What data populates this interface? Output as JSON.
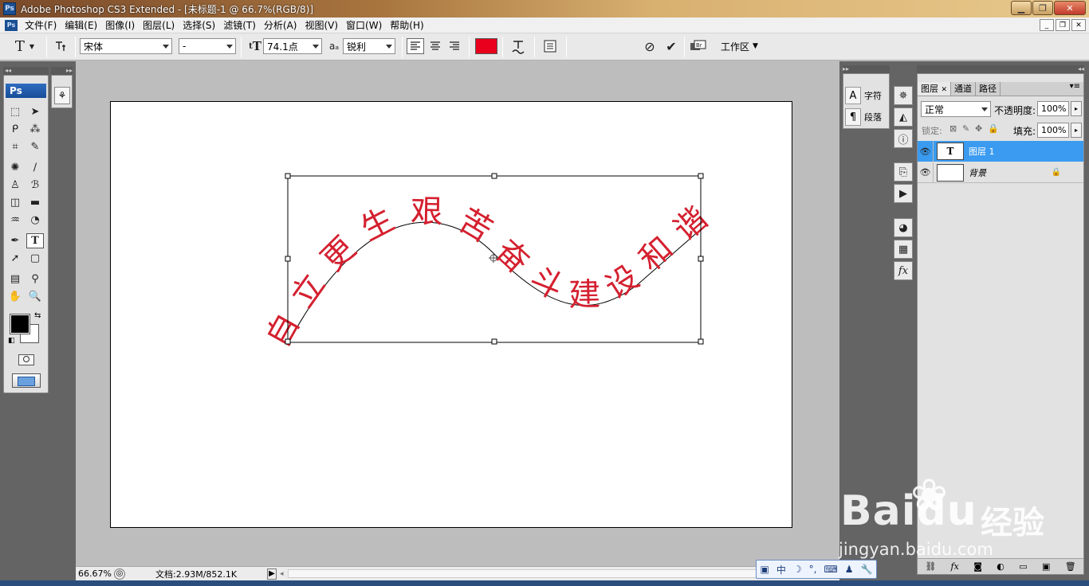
{
  "titlebar": {
    "icon_text": "Ps",
    "title": "Adobe Photoshop CS3 Extended - [未标题-1 @ 66.7%(RGB/8)]",
    "minimize": "▁",
    "maximize": "❐",
    "close": "✕"
  },
  "menubar": {
    "icon_text": "Ps",
    "items": [
      "文件(F)",
      "编辑(E)",
      "图像(I)",
      "图层(L)",
      "选择(S)",
      "滤镜(T)",
      "分析(A)",
      "视图(V)",
      "窗口(W)",
      "帮助(H)"
    ],
    "mdi_min": "_",
    "mdi_restore": "❐",
    "mdi_close": "✕"
  },
  "options": {
    "tool_glyph": "T",
    "font_family": "宋体",
    "font_style": "-",
    "font_size": "74.1点",
    "antialias_label": "aₐ",
    "antialias": "锐利",
    "text_color": "#e8001c",
    "workspace": "工作区"
  },
  "tools": {
    "logo": "Ps"
  },
  "document": {
    "text": "自立更生艰苦奋斗建设和谐",
    "text_color": "#d4202f"
  },
  "status": {
    "zoom": "66.67%",
    "docinfo": "文档:2.93M/852.1K"
  },
  "char_panel": {
    "char_label": "字符",
    "para_label": "段落",
    "char_icon": "A",
    "para_icon": "¶"
  },
  "layers": {
    "tabs": [
      "图层",
      "通道",
      "路径"
    ],
    "blend_mode": "正常",
    "opacity_label": "不透明度:",
    "opacity": "100%",
    "lock_label": "锁定:",
    "fill_label": "填充:",
    "fill": "100%",
    "rows": [
      {
        "name": "图层 1",
        "thumb": "T",
        "selected": true
      },
      {
        "name": "背景",
        "thumb": "",
        "selected": false
      }
    ],
    "bottom_icons": [
      "⛓",
      "fx",
      "◙",
      "◐",
      "▭",
      "▣",
      "🗑"
    ]
  },
  "ime": {
    "lang": "中"
  },
  "watermark": {
    "brand": "Bai",
    "brand2": "du",
    "cn": "经验",
    "url": "jingyan.baidu.com"
  }
}
